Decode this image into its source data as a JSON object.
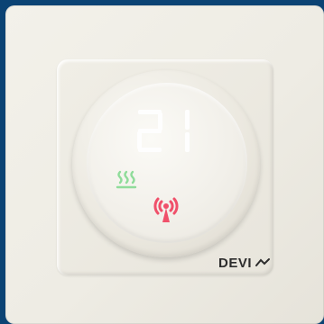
{
  "device": {
    "display_temperature": "21",
    "brand": "DEVI"
  },
  "indicators": {
    "heating_icon": "heating-icon",
    "wireless_icon": "wireless-signal-icon"
  },
  "colors": {
    "background": "#0b4374",
    "display_digits": "#ffffff",
    "heating_indicator": "#8fdc9a",
    "wireless_indicator": "#f0506a"
  }
}
